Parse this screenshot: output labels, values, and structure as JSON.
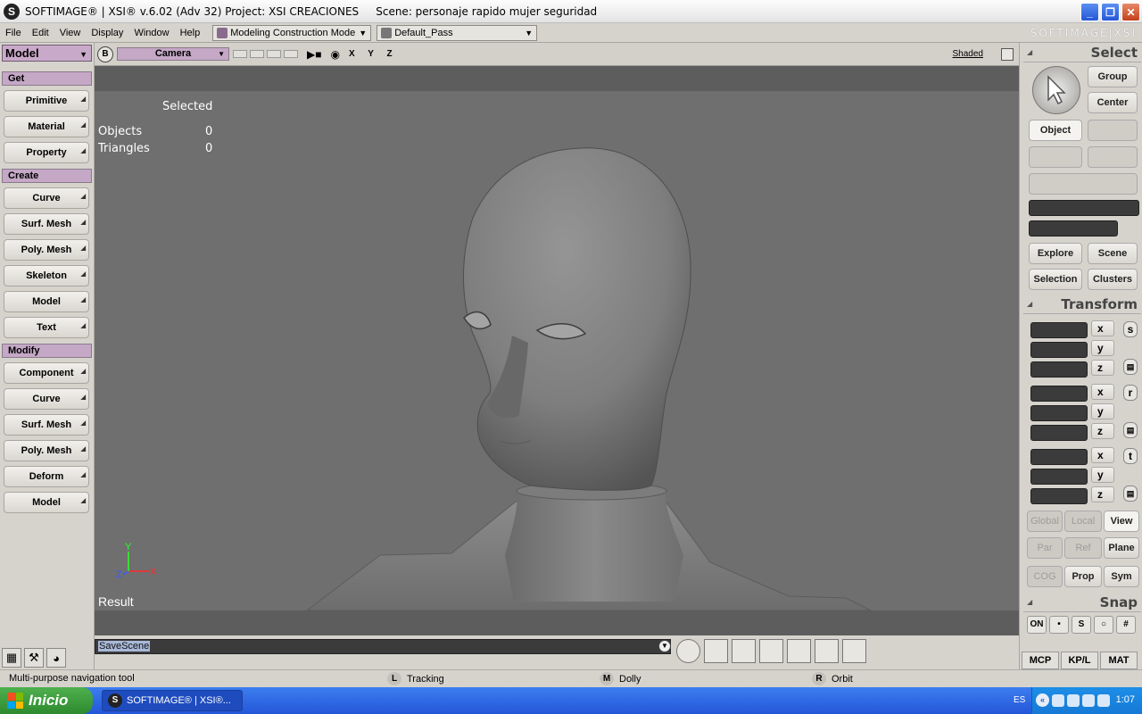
{
  "titlebar": {
    "title": "SOFTIMAGE® | XSI® v.6.02 (Adv 32) Project: XSI CREACIONES     Scene: personaje rapido mujer seguridad",
    "minimize": "_",
    "restore": "❐",
    "close": "✕"
  },
  "menubar": {
    "items": [
      "File",
      "Edit",
      "View",
      "Display",
      "Window",
      "Help"
    ],
    "mode": "Modeling Construction Mode",
    "pass": "Default_Pass",
    "brand": "SOFTIMAGE|XSI"
  },
  "left": {
    "module": "Model",
    "sections": [
      {
        "header": "Get",
        "buttons": [
          "Primitive",
          "Material",
          "Property"
        ]
      },
      {
        "header": "Create",
        "buttons": [
          "Curve",
          "Surf. Mesh",
          "Poly. Mesh",
          "Skeleton",
          "Model",
          "Text"
        ]
      },
      {
        "header": "Modify",
        "buttons": [
          "Component",
          "Curve",
          "Surf. Mesh",
          "Poly. Mesh",
          "Deform",
          "Model"
        ]
      }
    ]
  },
  "viewport": {
    "b_label": "B",
    "camera": "Camera",
    "axes": "X Y Z",
    "shading": "Shaded",
    "selected_label": "Selected",
    "objects_label": "Objects",
    "objects_value": "0",
    "triangles_label": "Triangles",
    "triangles_value": "0",
    "result_label": "Result",
    "axis_x": "X",
    "axis_y": "Y",
    "axis_z": "Z"
  },
  "right": {
    "select_title": "Select",
    "group": "Group",
    "center": "Center",
    "object": "Object",
    "explore": "Explore",
    "scene": "Scene",
    "selection": "Selection",
    "clusters": "Clusters",
    "transform_title": "Transform",
    "x": "x",
    "y": "y",
    "z": "z",
    "scale_key": "s",
    "rotate_key": "r",
    "translate_key": "t",
    "global": "Global",
    "local": "Local",
    "view": "View",
    "par": "Par",
    "ref": "Ref",
    "plane": "Plane",
    "cog": "COG",
    "prop": "Prop",
    "sym": "Sym",
    "snap_title": "Snap",
    "snap_on": "ON",
    "tabs": [
      "MCP",
      "KP/L",
      "MAT"
    ]
  },
  "cmdbar": {
    "command": "SaveScene"
  },
  "statusbar": {
    "message": "Multi-purpose navigation tool",
    "left_key": "L",
    "left_action": "Tracking",
    "middle_key": "M",
    "middle_action": "Dolly",
    "right_key": "R",
    "right_action": "Orbit"
  },
  "taskbar": {
    "start": "Inicio",
    "task": "SOFTIMAGE® | XSI®...",
    "lang": "ES",
    "clock": "1:07"
  },
  "colors": {
    "viewport_bg": "#6f6f6f",
    "section_header": "#c4a8c6",
    "taskbar": "#2456d8",
    "start": "#3a9a3a"
  }
}
